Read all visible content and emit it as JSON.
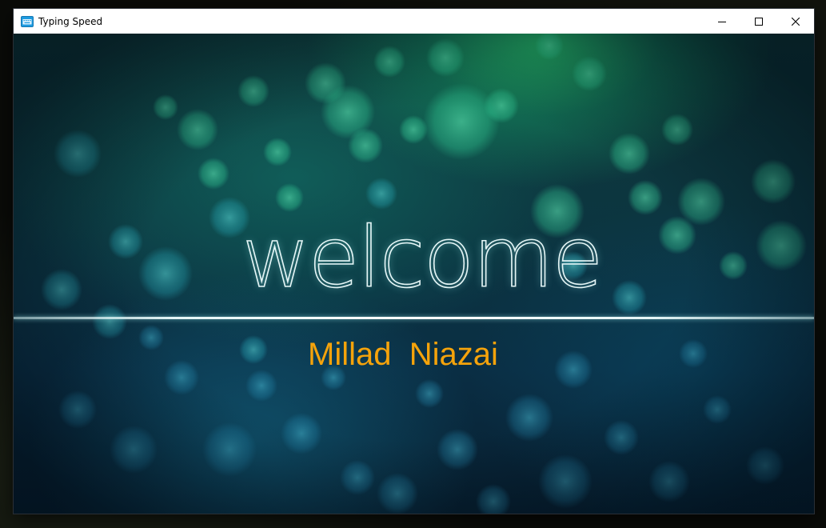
{
  "window": {
    "title": "Typing Speed",
    "icon": "keyboard-app-icon"
  },
  "caption_buttons": {
    "minimize": "minimize-icon",
    "maximize": "maximize-icon",
    "close": "close-icon"
  },
  "splash": {
    "welcome": "welcome",
    "user_name": "Millad  Niazai"
  },
  "colors": {
    "name_text": "#f5a30b",
    "background_top": "#1fae6a",
    "background_bottom": "#0a2e44"
  }
}
